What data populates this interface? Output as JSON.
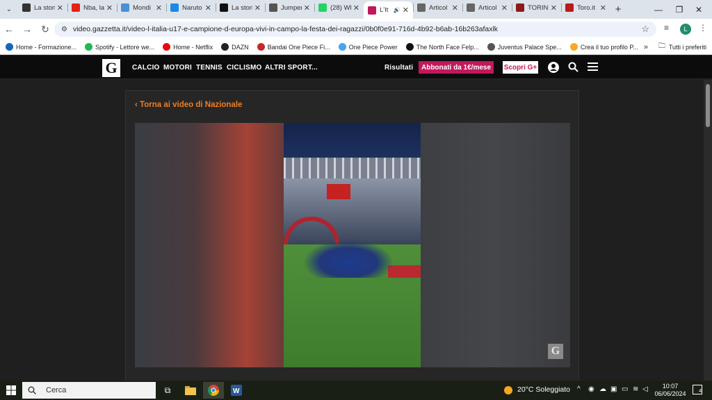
{
  "browser": {
    "tabs": [
      {
        "title": "La storia",
        "icon": "incognito-icon",
        "color": "#333333"
      },
      {
        "title": "Nba, la",
        "icon": "youtube-icon",
        "color": "#e62117"
      },
      {
        "title": "Mondi",
        "icon": "play-icon",
        "color": "#4a90d9"
      },
      {
        "title": "Naruto",
        "icon": "naruto-icon",
        "color": "#1e88e5"
      },
      {
        "title": "La storia",
        "icon": "v-icon",
        "color": "#111111"
      },
      {
        "title": "Jumper",
        "icon": "wikipedia-icon",
        "color": "#555555"
      },
      {
        "title": "(28) Wh",
        "icon": "whatsapp-icon",
        "color": "#25d366"
      },
      {
        "title": "L'It",
        "icon": "gazzetta-icon",
        "color": "#c2185b",
        "active": true
      },
      {
        "title": "Articol",
        "icon": "globe-icon",
        "color": "#666666"
      },
      {
        "title": "Articol",
        "icon": "globe-icon",
        "color": "#666666"
      },
      {
        "title": "TORINO",
        "icon": "torino-icon",
        "color": "#8b1a1a"
      },
      {
        "title": "Toro.it",
        "icon": "toro-icon",
        "color": "#b71c1c"
      }
    ],
    "url": "video.gazzetta.it/video-l-italia-u17-e-campione-d-europa-vivi-in-campo-la-festa-dei-ragazzi/0b0f0e91-716d-4b92-b6ab-16b263afaxlk",
    "profile_initial": "L",
    "bookmarks": [
      {
        "label": "Home - Formazione...",
        "icon": "formazione-icon",
        "color": "#1565c0"
      },
      {
        "label": "Spotify - Lettore we...",
        "icon": "spotify-icon",
        "color": "#1db954"
      },
      {
        "label": "Home - Netflix",
        "icon": "netflix-icon",
        "color": "#e50914"
      },
      {
        "label": "DAZN",
        "icon": "dazn-icon",
        "color": "#222222"
      },
      {
        "label": "Bandai One Piece Fi...",
        "icon": "bandai-icon",
        "color": "#c62828"
      },
      {
        "label": "One Piece Power",
        "icon": "onepiece-icon",
        "color": "#42a5f5"
      },
      {
        "label": "The North Face Felp...",
        "icon": "northface-icon",
        "color": "#111111"
      },
      {
        "label": "Juventus Palace Spe...",
        "icon": "juventus-icon",
        "color": "#555555"
      },
      {
        "label": "Crea il tuo profilo P...",
        "icon": "profile-bookmark-icon",
        "color": "#f9a825"
      }
    ],
    "all_bookmarks_label": "Tutti i preferiti"
  },
  "site": {
    "logo": "G",
    "nav": [
      "CALCIO",
      "MOTORI",
      "TENNIS",
      "CICLISMO",
      "ALTRI SPORT",
      "..."
    ],
    "results_label": "Risultati",
    "subscribe_label": "Abbonati da 1€/mese",
    "discover_label": "Scopri G+"
  },
  "page": {
    "back_link": "Torna ai video di Nazionale",
    "watermark": "G"
  },
  "taskbar": {
    "search_placeholder": "Cerca",
    "weather": "20°C Soleggiato",
    "time": "10:07",
    "date": "06/06/2024",
    "notifications": "4"
  }
}
